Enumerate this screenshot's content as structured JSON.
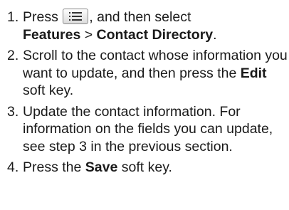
{
  "steps": [
    {
      "number": "1.",
      "line1_pre": "Press ",
      "icon": "menu-list-icon",
      "line1_post": ", and then select",
      "bold_a": "Features",
      "sep": " > ",
      "bold_b": "Contact Directory",
      "end": "."
    },
    {
      "number": "2.",
      "text": "Scroll to the contact whose information you want to update, and then press the ",
      "bold": "Edit",
      "text_after": " soft key."
    },
    {
      "number": "3.",
      "text": "Update the contact information. For information on the fields you can update, see step 3 in the previous section."
    },
    {
      "number": "4.",
      "text": "Press the ",
      "bold": "Save",
      "text_after": " soft key."
    }
  ]
}
